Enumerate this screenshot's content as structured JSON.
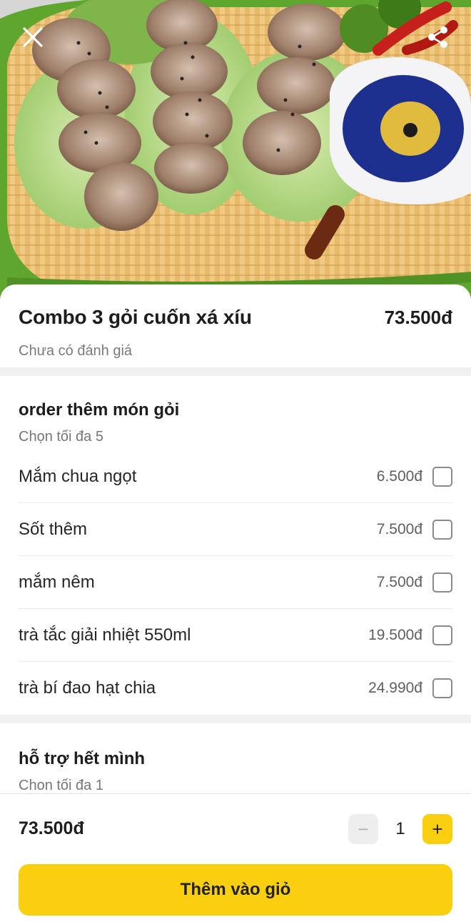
{
  "hero": {
    "image_description": "gỏi cuốn",
    "close_icon": "close-icon",
    "share_icon": "share-icon"
  },
  "product": {
    "name": "Combo 3 gỏi cuốn xá xíu",
    "price": "73.500đ",
    "rating_text": "Chưa có đánh giá"
  },
  "option_group_1": {
    "title": "order thêm món gỏi",
    "subtitle": "Chọn tối đa 5",
    "options": [
      {
        "name": "Mắm chua ngọt",
        "price": "6.500đ",
        "checked": false
      },
      {
        "name": "Sốt thêm",
        "price": "7.500đ",
        "checked": false
      },
      {
        "name": "mắm nêm",
        "price": "7.500đ",
        "checked": false
      },
      {
        "name": "trà tắc giải nhiệt 550ml",
        "price": "19.500đ",
        "checked": false
      },
      {
        "name": "trà bí đao hạt chia",
        "price": "24.990đ",
        "checked": false
      }
    ]
  },
  "option_group_2": {
    "title": "hỗ trợ hết mình",
    "subtitle": "Chon tối đa 1"
  },
  "footer": {
    "total": "73.500đ",
    "quantity": "1",
    "minus_label": "−",
    "plus_label": "+",
    "add_to_cart_label": "Thêm vào giỏ"
  },
  "colors": {
    "accent": "#f9cf10",
    "basket_rim": "#5ea62e",
    "section_divider": "#f0f0f0"
  }
}
